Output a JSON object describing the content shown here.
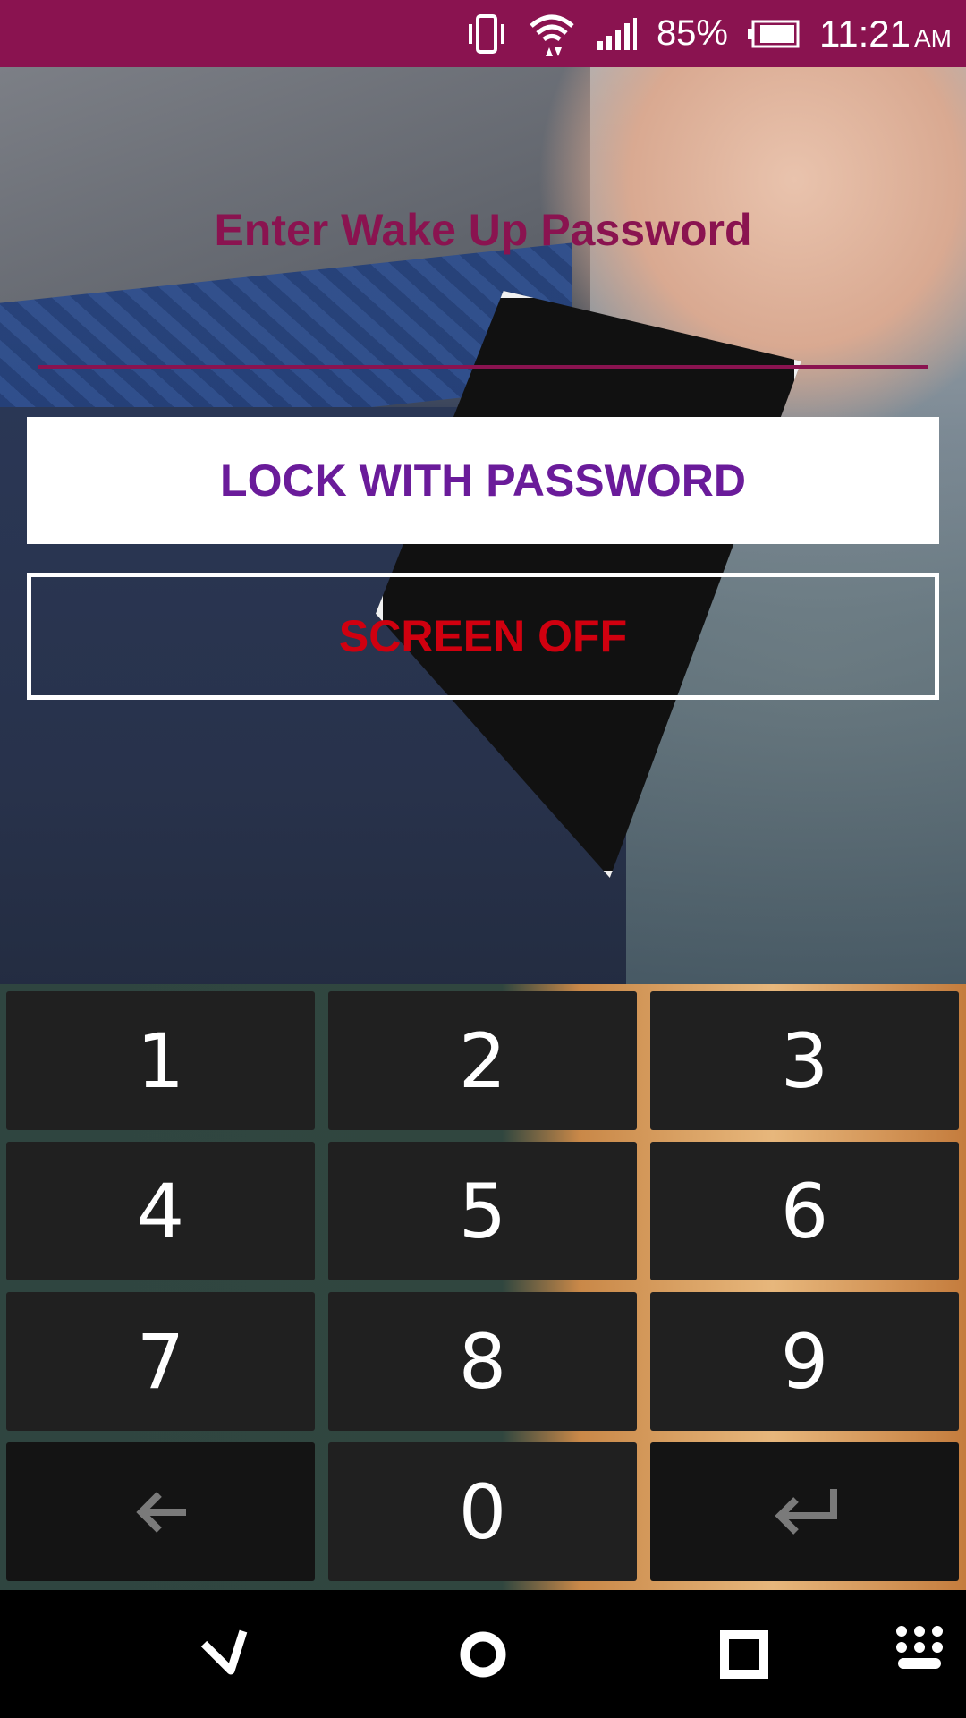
{
  "status_bar": {
    "battery_percent": "85%",
    "time": "11:21",
    "ampm": "AM",
    "icons": [
      "vibrate-icon",
      "wifi-icon",
      "signal-icon",
      "battery-icon"
    ],
    "background": "#8a1350"
  },
  "form": {
    "title": "Enter Wake Up Password",
    "lock_button_label": "LOCK WITH PASSWORD",
    "screen_off_button_label": "SCREEN OFF",
    "colors": {
      "title": "#8a1350",
      "lock_label": "#6a1b9a",
      "screen_off_label": "#d0000f"
    }
  },
  "keypad": {
    "keys": [
      "1",
      "2",
      "3",
      "4",
      "5",
      "6",
      "7",
      "8",
      "9",
      "0"
    ],
    "backspace_icon": "backspace-arrow-icon",
    "enter_icon": "enter-icon"
  },
  "nav_bar": {
    "icons": [
      "back-icon",
      "home-icon",
      "recents-icon",
      "keyboard-icon"
    ]
  }
}
